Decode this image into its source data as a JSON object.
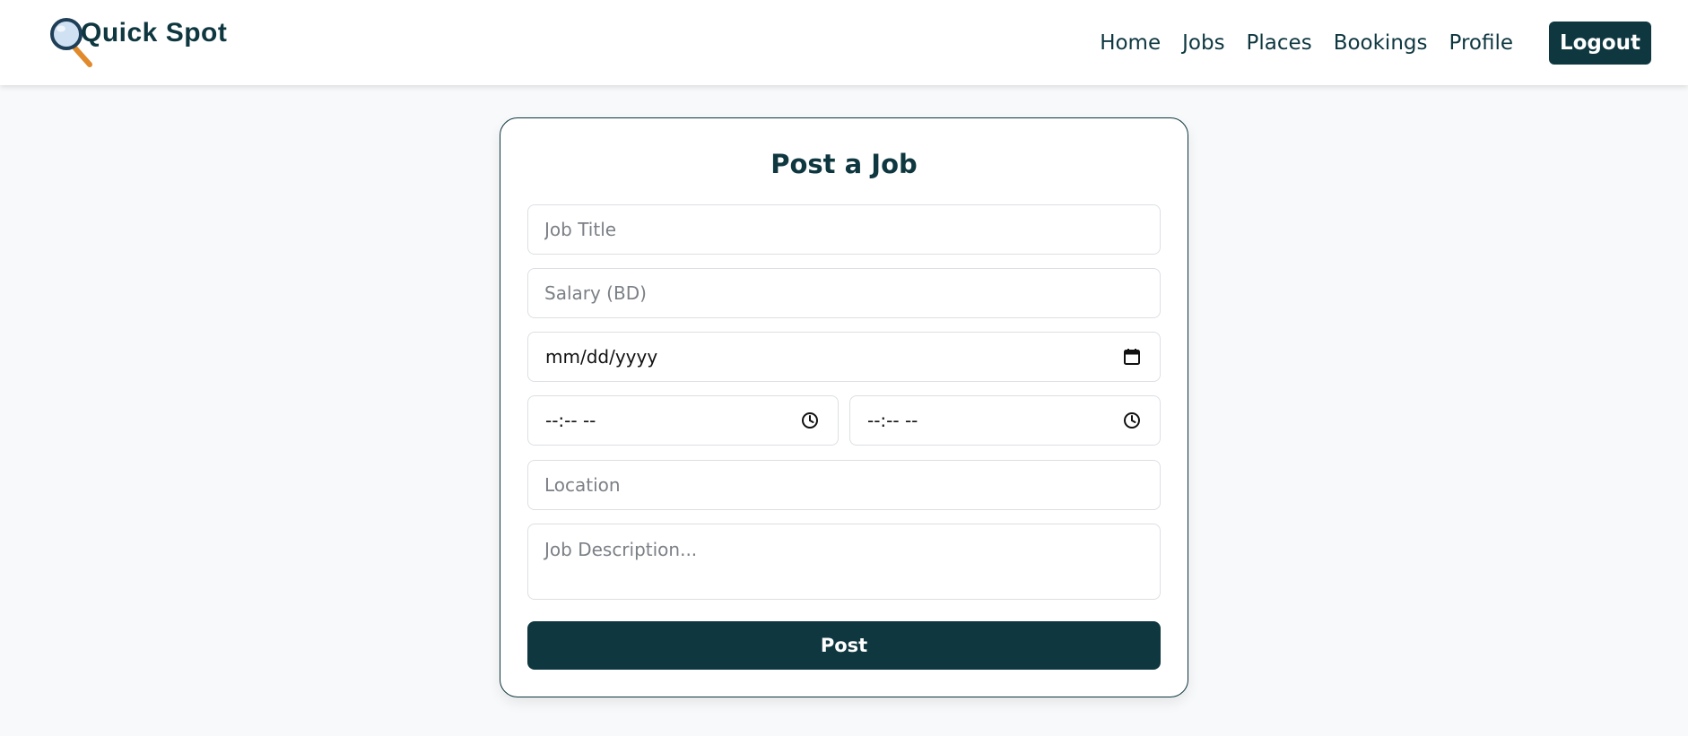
{
  "brand": {
    "name": "Quick Spot",
    "icon": "magnifying-glass-icon"
  },
  "nav": {
    "links": [
      "Home",
      "Jobs",
      "Places",
      "Bookings",
      "Profile"
    ],
    "logout_label": "Logout"
  },
  "form": {
    "title": "Post a Job",
    "job_title_placeholder": "Job Title",
    "salary_placeholder": "Salary (BD)",
    "date_display": "mm/dd/yyyy",
    "date_icon": "calendar-icon",
    "start_time_display": "--:-- --",
    "end_time_display": "--:-- --",
    "time_icon": "clock-icon",
    "location_placeholder": "Location",
    "description_placeholder": "Job Description...",
    "submit_label": "Post"
  },
  "colors": {
    "primary": "#0e3740",
    "background": "#f8f9fa",
    "card_background": "#ffffff",
    "input_border": "#dcdfe3",
    "placeholder": "#7b8086"
  }
}
